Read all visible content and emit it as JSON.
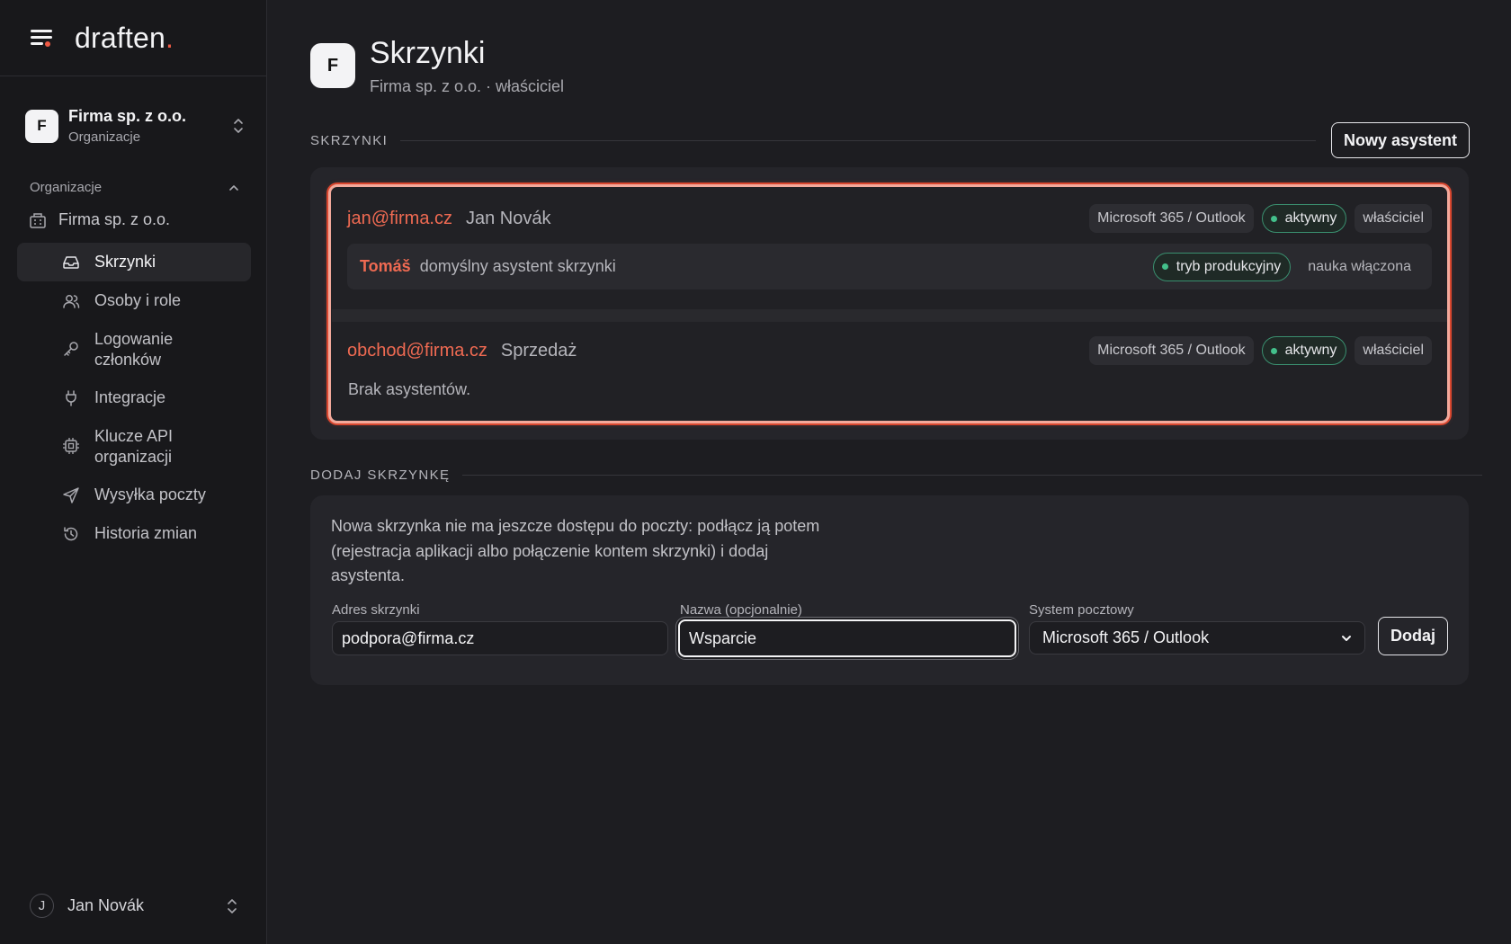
{
  "app": {
    "logo": "draften",
    "logo_dot": "."
  },
  "sidebar": {
    "org": {
      "avatar": "F",
      "name": "Firma sp. z o.o.",
      "sub": "Organizacje"
    },
    "section_label": "Organizacje",
    "org_item": "Firma sp. z o.o.",
    "items": [
      {
        "label": "Skrzynki",
        "icon": "inbox-icon",
        "active": true
      },
      {
        "label": "Osoby i role",
        "icon": "users-icon"
      },
      {
        "label": "Logowanie członków",
        "icon": "key-icon"
      },
      {
        "label": "Integracje",
        "icon": "plug-icon"
      },
      {
        "label": "Klucze API organizacji",
        "icon": "chip-icon"
      },
      {
        "label": "Wysyłka poczty",
        "icon": "send-icon"
      },
      {
        "label": "Historia zmian",
        "icon": "history-icon"
      }
    ],
    "user": {
      "avatar": "J",
      "name": "Jan Novák"
    }
  },
  "header": {
    "avatar": "F",
    "title": "Skrzynki",
    "subtitle": "Firma sp. z o.o. · właściciel"
  },
  "mailboxes_section": {
    "label": "SKRZYNKI",
    "new_assistant_label": "Nowy asystent",
    "mailboxes": [
      {
        "email": "jan@firma.cz",
        "name": "Jan Novák",
        "provider": "Microsoft 365 / Outlook",
        "status": "aktywny",
        "role": "właściciel",
        "assistant": {
          "name": "Tomáš",
          "desc": "domyślny asystent skrzynki",
          "mode": "tryb produkcyjny",
          "learning": "nauka włączona"
        }
      },
      {
        "email": "obchod@firma.cz",
        "name": "Sprzedaż",
        "provider": "Microsoft 365 / Outlook",
        "status": "aktywny",
        "role": "właściciel",
        "empty": "Brak asystentów."
      }
    ]
  },
  "add_section": {
    "label": "DODAJ SKRZYNKĘ",
    "desc_lines": [
      "Nowa skrzynka nie ma jeszcze dostępu do poczty: podłącz ją potem",
      "(rejestracja aplikacji albo połączenie kontem skrzynki) i dodaj",
      "asystenta."
    ],
    "address_label": "Adres skrzynki",
    "address_value": "podpora@firma.cz",
    "name_label": "Nazwa (opcjonalnie)",
    "name_value": "Wsparcie",
    "system_label": "System pocztowy",
    "system_value": "Microsoft 365 / Outlook",
    "submit_label": "Dodaj"
  },
  "colors": {
    "accent": "#ef5a45",
    "status_green": "#43c08b",
    "bg": "#1d1d21",
    "sidebar_bg": "#18181b"
  }
}
